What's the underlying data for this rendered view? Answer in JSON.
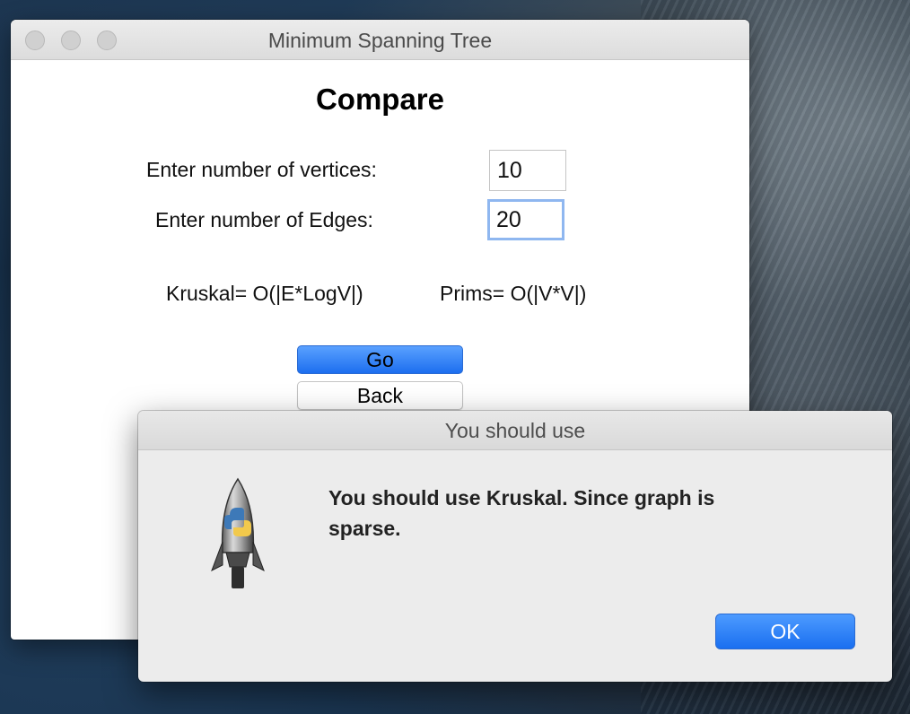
{
  "window": {
    "title": "Minimum Spanning Tree",
    "heading": "Compare",
    "vertices_label": "Enter number of vertices:",
    "vertices_value": "10",
    "edges_label": "Enter number of Edges:",
    "edges_value": "20",
    "kruskal_complexity": "Kruskal= O(|E*LogV|)",
    "prims_complexity": "Prims= O(|V*V|)",
    "go_label": "Go",
    "back_label": "Back"
  },
  "dialog": {
    "title": "You should use",
    "message": "You should use Kruskal. Since graph is sparse.",
    "ok_label": "OK",
    "icon": "python-launcher-rocket-icon"
  },
  "colors": {
    "accent_blue": "#1c6eef",
    "focus_ring": "#8fb7f0"
  }
}
